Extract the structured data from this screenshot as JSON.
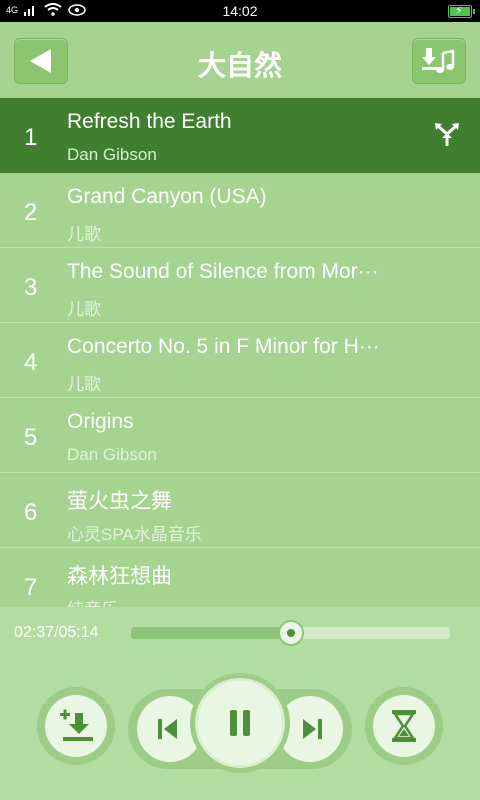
{
  "status": {
    "signal": "4G",
    "time": "14:02"
  },
  "header": {
    "title": "大自然"
  },
  "tracks": [
    {
      "num": "1",
      "title": "Refresh the Earth",
      "artist": "Dan Gibson"
    },
    {
      "num": "2",
      "title": "Grand Canyon (USA)",
      "artist": "儿歌"
    },
    {
      "num": "3",
      "title": "The Sound of Silence from Mor···",
      "artist": "儿歌"
    },
    {
      "num": "4",
      "title": "Concerto No. 5 in F Minor for H···",
      "artist": "儿歌"
    },
    {
      "num": "5",
      "title": "Origins",
      "artist": "Dan Gibson"
    },
    {
      "num": "6",
      "title": "萤火虫之舞",
      "artist": "心灵SPA水晶音乐"
    },
    {
      "num": "7",
      "title": "森林狂想曲",
      "artist": "纯音乐"
    }
  ],
  "player": {
    "time": "02:37/05:14",
    "progress_fraction": 0.5
  },
  "colors": {
    "header": "#a6d38f",
    "active_row": "#3f7f2f",
    "player_bg": "#b3dca0",
    "button_ring": "#9ccc86"
  },
  "icons": {
    "back": "back-arrow-icon",
    "download": "download-music-icon",
    "share": "share-icon",
    "add": "add-to-download-icon",
    "prev": "previous-track-icon",
    "pause": "pause-icon",
    "next": "next-track-icon",
    "timer": "sleep-timer-icon"
  }
}
